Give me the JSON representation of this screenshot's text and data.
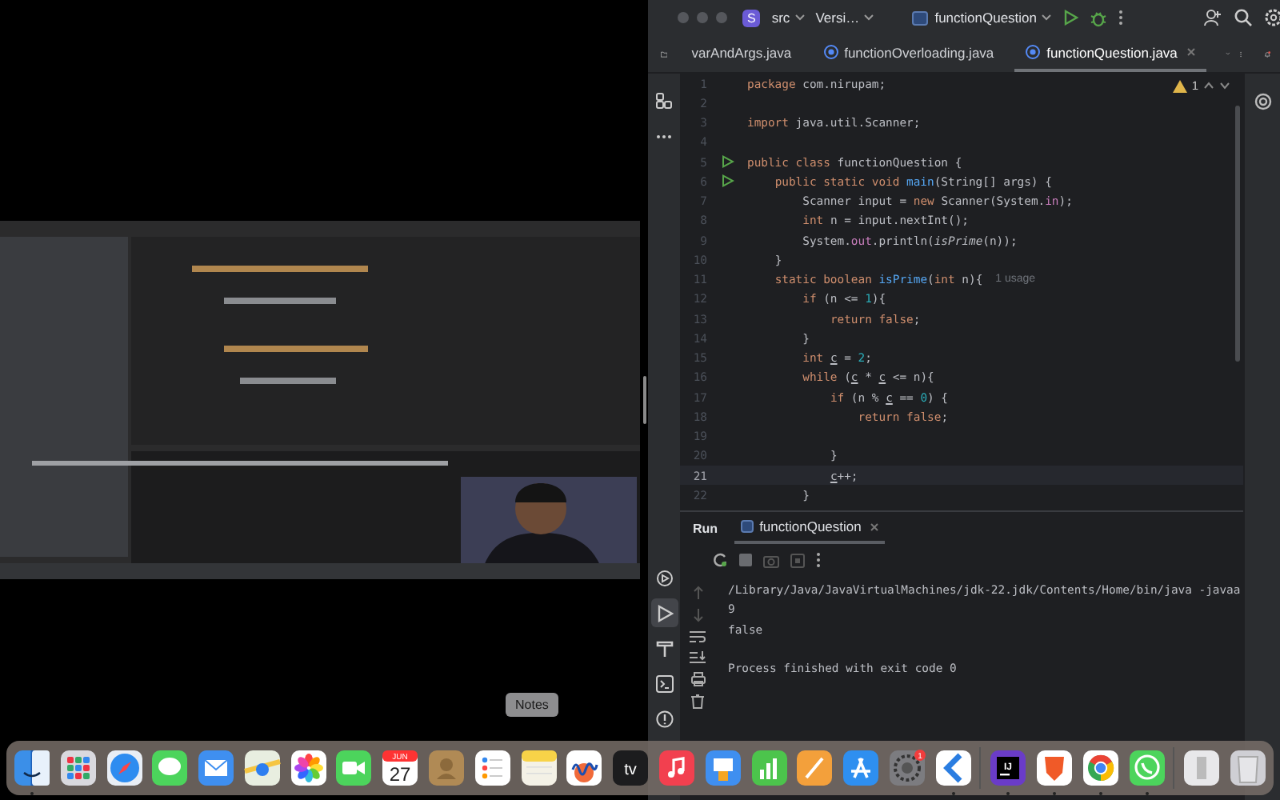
{
  "toolbar": {
    "project_badge": "S",
    "project": "src",
    "vcs": "Versi…",
    "run_config": "functionQuestion"
  },
  "tabs": [
    {
      "label": "varAndArgs.java",
      "kind": "file",
      "selected": false
    },
    {
      "label": "functionOverloading.java",
      "kind": "class",
      "selected": false
    },
    {
      "label": "functionQuestion.java",
      "kind": "class",
      "selected": true
    }
  ],
  "tool_stripe": {
    "top": [
      {
        "kind": "project",
        "selected": false
      },
      {
        "kind": "structure",
        "selected": false
      },
      {
        "kind": "more",
        "selected": false
      }
    ],
    "bottom": [
      {
        "kind": "services",
        "selected": false
      },
      {
        "kind": "run",
        "selected": true
      },
      {
        "kind": "build",
        "selected": false
      },
      {
        "kind": "terminal",
        "selected": false
      },
      {
        "kind": "problems",
        "selected": false
      }
    ]
  },
  "editor": {
    "warnings": "1",
    "lines": [
      {
        "number": "1",
        "current": false,
        "runnable": false,
        "tokens": [
          {
            "text": "package",
            "kind": "kw"
          },
          {
            "text": " com.nirupam;",
            "kind": "plain"
          }
        ]
      },
      {
        "number": "2",
        "current": false,
        "runnable": false
      },
      {
        "number": "3",
        "current": false,
        "runnable": false,
        "tokens": [
          {
            "text": "import",
            "kind": "kw"
          },
          {
            "text": " java.util.Scanner;",
            "kind": "plain"
          }
        ]
      },
      {
        "number": "4",
        "current": false,
        "runnable": false
      },
      {
        "number": "5",
        "current": false,
        "runnable": true,
        "tokens": [
          {
            "text": "public class",
            "kind": "kw"
          },
          {
            "text": " functionQuestion {",
            "kind": "plain"
          }
        ]
      },
      {
        "number": "6",
        "current": false,
        "runnable": true,
        "tokens": [
          {
            "text": "    public static void",
            "kind": "kw"
          },
          {
            "text": " main",
            "kind": "decl"
          },
          {
            "text": "(String[] args) {",
            "kind": "plain"
          }
        ]
      },
      {
        "number": "7",
        "current": false,
        "runnable": false,
        "tokens": [
          {
            "text": "        Scanner input = ",
            "kind": "plain"
          },
          {
            "text": "new",
            "kind": "kw"
          },
          {
            "text": " Scanner(System.",
            "kind": "plain"
          },
          {
            "text": "in",
            "kind": "field"
          },
          {
            "text": ");",
            "kind": "plain"
          }
        ]
      },
      {
        "number": "8",
        "current": false,
        "runnable": false,
        "tokens": [
          {
            "text": "        int",
            "kind": "kw"
          },
          {
            "text": " n = input.nextInt();",
            "kind": "plain"
          }
        ]
      },
      {
        "number": "9",
        "current": false,
        "runnable": false,
        "tokens": [
          {
            "text": "        System.",
            "kind": "plain"
          },
          {
            "text": "out",
            "kind": "field"
          },
          {
            "text": ".println(",
            "kind": "plain"
          },
          {
            "text": "isPrime",
            "kind": "call"
          },
          {
            "text": "(n));",
            "kind": "plain"
          }
        ]
      },
      {
        "number": "10",
        "current": false,
        "runnable": false,
        "tokens": [
          {
            "text": "    }",
            "kind": "plain"
          }
        ]
      },
      {
        "number": "11",
        "current": false,
        "runnable": false,
        "hint": "1 usage",
        "tokens": [
          {
            "text": "    static boolean",
            "kind": "kw"
          },
          {
            "text": " isPrime",
            "kind": "decl"
          },
          {
            "text": "(",
            "kind": "plain"
          },
          {
            "text": "int",
            "kind": "kw"
          },
          {
            "text": " n){",
            "kind": "plain"
          }
        ]
      },
      {
        "number": "12",
        "current": false,
        "runnable": false,
        "tokens": [
          {
            "text": "        if",
            "kind": "kw"
          },
          {
            "text": " (n <= ",
            "kind": "plain"
          },
          {
            "text": "1",
            "kind": "num"
          },
          {
            "text": "){",
            "kind": "plain"
          }
        ]
      },
      {
        "number": "13",
        "current": false,
        "runnable": false,
        "tokens": [
          {
            "text": "            return false",
            "kind": "kw"
          },
          {
            "text": ";",
            "kind": "plain"
          }
        ]
      },
      {
        "number": "14",
        "current": false,
        "runnable": false,
        "tokens": [
          {
            "text": "        }",
            "kind": "plain"
          }
        ]
      },
      {
        "number": "15",
        "current": false,
        "runnable": false,
        "tokens": [
          {
            "text": "        int",
            "kind": "kw"
          },
          {
            "text": " c",
            "kind": "var"
          },
          {
            "text": " = ",
            "kind": "plain"
          },
          {
            "text": "2",
            "kind": "num"
          },
          {
            "text": ";",
            "kind": "plain"
          }
        ]
      },
      {
        "number": "16",
        "current": false,
        "runnable": false,
        "tokens": [
          {
            "text": "        while",
            "kind": "kw"
          },
          {
            "text": " (",
            "kind": "plain"
          },
          {
            "text": "c",
            "kind": "var"
          },
          {
            "text": " * ",
            "kind": "plain"
          },
          {
            "text": "c",
            "kind": "var"
          },
          {
            "text": " <= n){",
            "kind": "plain"
          }
        ]
      },
      {
        "number": "17",
        "current": false,
        "runnable": false,
        "tokens": [
          {
            "text": "            if",
            "kind": "kw"
          },
          {
            "text": " (n % ",
            "kind": "plain"
          },
          {
            "text": "c",
            "kind": "var"
          },
          {
            "text": " == ",
            "kind": "plain"
          },
          {
            "text": "0",
            "kind": "num"
          },
          {
            "text": ") {",
            "kind": "plain"
          }
        ]
      },
      {
        "number": "18",
        "current": false,
        "runnable": false,
        "tokens": [
          {
            "text": "                return false",
            "kind": "kw"
          },
          {
            "text": ";",
            "kind": "plain"
          }
        ]
      },
      {
        "number": "19",
        "current": false,
        "runnable": false
      },
      {
        "number": "20",
        "current": false,
        "runnable": false,
        "tokens": [
          {
            "text": "            }",
            "kind": "plain"
          }
        ]
      },
      {
        "number": "21",
        "current": true,
        "runnable": false,
        "tokens": [
          {
            "text": "            c",
            "kind": "var"
          },
          {
            "text": "++;",
            "kind": "plain"
          }
        ]
      },
      {
        "number": "22",
        "current": false,
        "runnable": false,
        "tokens": [
          {
            "text": "        }",
            "kind": "plain"
          }
        ]
      }
    ]
  },
  "run_panel": {
    "title": "Run",
    "tab": "functionQuestion",
    "output": [
      {
        "text": "/Library/Java/JavaVirtualMachines/jdk-22.jdk/Contents/Home/bin/java -javaa",
        "gap_before": false
      },
      {
        "text": "9",
        "gap_before": false
      },
      {
        "text": "false",
        "gap_before": false
      },
      {
        "text": "Process finished with exit code 0",
        "gap_before": true
      }
    ]
  },
  "tooltip": "Notes",
  "dock": {
    "items": [
      {
        "kind": "face",
        "running": true
      },
      {
        "kind": "grid",
        "running": false
      },
      {
        "kind": "compass",
        "running": false
      },
      {
        "kind": "bubble",
        "running": false
      },
      {
        "kind": "envelope",
        "running": false
      },
      {
        "kind": "map",
        "running": false
      },
      {
        "kind": "flower",
        "running": false
      },
      {
        "kind": "camera",
        "running": false
      },
      {
        "kind": "calendar",
        "running": false,
        "month": "JUN",
        "day": "27"
      },
      {
        "kind": "card",
        "running": false
      },
      {
        "kind": "list",
        "running": false
      },
      {
        "kind": "notepad",
        "running": false
      },
      {
        "kind": "squiggle",
        "running": false
      },
      {
        "kind": "tv",
        "running": false,
        "label": "tv"
      },
      {
        "kind": "music",
        "running": false
      },
      {
        "kind": "podium",
        "running": false
      },
      {
        "kind": "bars",
        "running": false
      },
      {
        "kind": "pencil",
        "running": false
      },
      {
        "kind": "sticks",
        "running": false
      },
      {
        "kind": "gear",
        "running": false,
        "badge": "1"
      },
      {
        "kind": "chevron",
        "running": true
      },
      {
        "kind": "separator"
      },
      {
        "kind": "ij",
        "running": true,
        "label": "IJ"
      },
      {
        "kind": "shield",
        "running": true
      },
      {
        "kind": "ring",
        "running": true
      },
      {
        "kind": "phone",
        "running": true
      },
      {
        "kind": "separator"
      },
      {
        "kind": "document",
        "running": false
      },
      {
        "kind": "trash",
        "running": false
      }
    ]
  }
}
